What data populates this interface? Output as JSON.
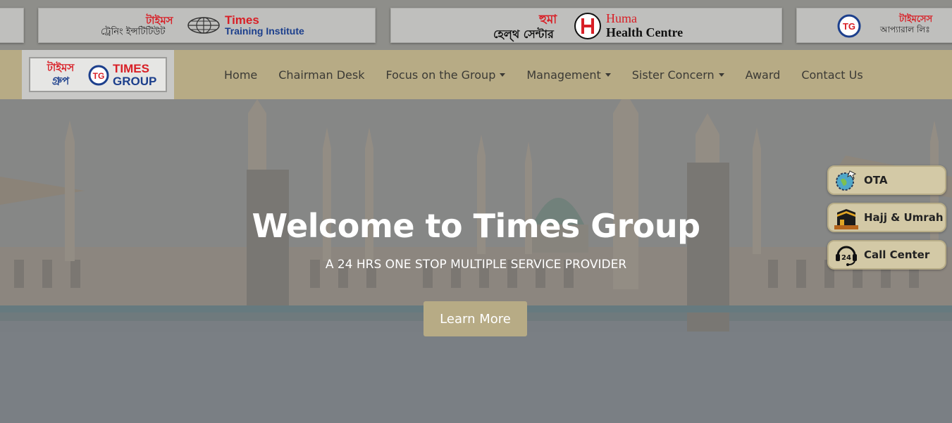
{
  "ticker": {
    "cards": [
      {
        "bn": "",
        "en": ""
      },
      {
        "bn": "টাইমস",
        "bn2": "ট্রেনিং ইন্সটিটিউট",
        "en1": "Times",
        "en2": "Training Institute"
      },
      {
        "bn": "হুমা",
        "bn2": "হেল্থ সেন্টার",
        "en1": "Huma",
        "en2": "Health Centre"
      },
      {
        "bn": "টাইমসেস",
        "bn2": "আপ্যারাল লিঃ"
      }
    ]
  },
  "brand": {
    "bn_line1": "টাইমস",
    "bn_line2": "গ্রুপ",
    "en_line1": "TIMES",
    "en_line2": "GROUP"
  },
  "nav": {
    "items": [
      {
        "label": "Home",
        "dropdown": false
      },
      {
        "label": "Chairman Desk",
        "dropdown": false
      },
      {
        "label": "Focus on the Group",
        "dropdown": true
      },
      {
        "label": "Management",
        "dropdown": true
      },
      {
        "label": "Sister Concern",
        "dropdown": true
      },
      {
        "label": "Award",
        "dropdown": false
      },
      {
        "label": "Contact Us",
        "dropdown": false
      }
    ]
  },
  "hero": {
    "title": "Welcome to Times Group",
    "subtitle": "A 24 HRS ONE STOP MULTIPLE SERVICE PROVIDER",
    "button_label": "Learn More"
  },
  "floating": {
    "ota": {
      "label": "OTA",
      "icon": "globe-plane-icon"
    },
    "hajj": {
      "label": "Hajj & Umrah",
      "icon": "kaaba-icon"
    },
    "call": {
      "label": "Call Center",
      "icon": "call-24-icon",
      "badge": "24"
    }
  },
  "colors": {
    "nav_bg": "#b7ab85",
    "brand_red": "#d81f26",
    "brand_blue": "#1c3f8c",
    "float_bg": "#d3c9a6"
  }
}
